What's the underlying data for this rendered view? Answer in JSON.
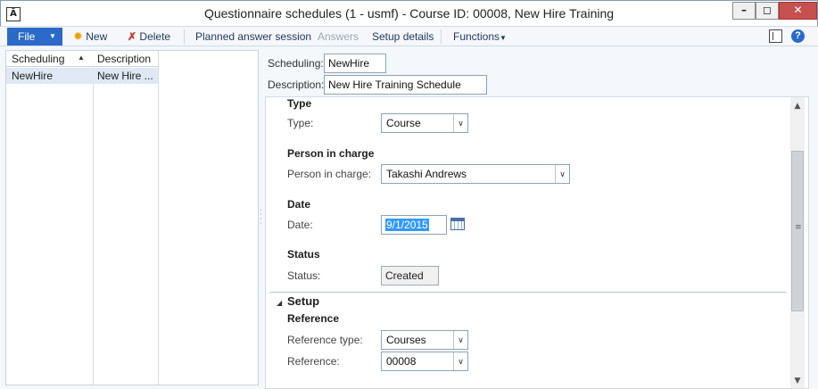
{
  "window": {
    "title": "Questionnaire schedules (1 - usmf) - Course ID: 00008, New Hire Training",
    "app_icon": "ax-app-icon",
    "minimize_glyph": "–",
    "maximize_glyph": "◻",
    "close_glyph": "✕"
  },
  "toolbar": {
    "file_label": "File",
    "new_label": "New",
    "delete_label": "Delete",
    "planned_label": "Planned answer session",
    "answers_label": "Answers",
    "setup_label": "Setup details",
    "functions_label": "Functions",
    "help_glyph": "?"
  },
  "grid": {
    "columns": [
      "Scheduling",
      "Description"
    ],
    "rows": [
      {
        "scheduling": "NewHire",
        "description": "New Hire ..."
      }
    ]
  },
  "header": {
    "scheduling_label": "Scheduling:",
    "scheduling_value": "NewHire",
    "description_label": "Description:",
    "description_value": "New Hire Training Schedule"
  },
  "form": {
    "type_heading": "Type",
    "type_label": "Type:",
    "type_value": "Course",
    "person_heading": "Person in charge",
    "person_label": "Person in charge:",
    "person_value": "Takashi Andrews",
    "date_heading": "Date",
    "date_label": "Date:",
    "date_value": "9/1/2015",
    "status_heading": "Status",
    "status_label": "Status:",
    "status_value": "Created",
    "setup_heading": "Setup",
    "reference_heading": "Reference",
    "reference_type_label": "Reference type:",
    "reference_type_value": "Courses",
    "reference_label": "Reference:",
    "reference_value": "00008"
  },
  "colors": {
    "accent": "#2b6ac7",
    "close": "#c75050",
    "selection": "#3399ff"
  }
}
